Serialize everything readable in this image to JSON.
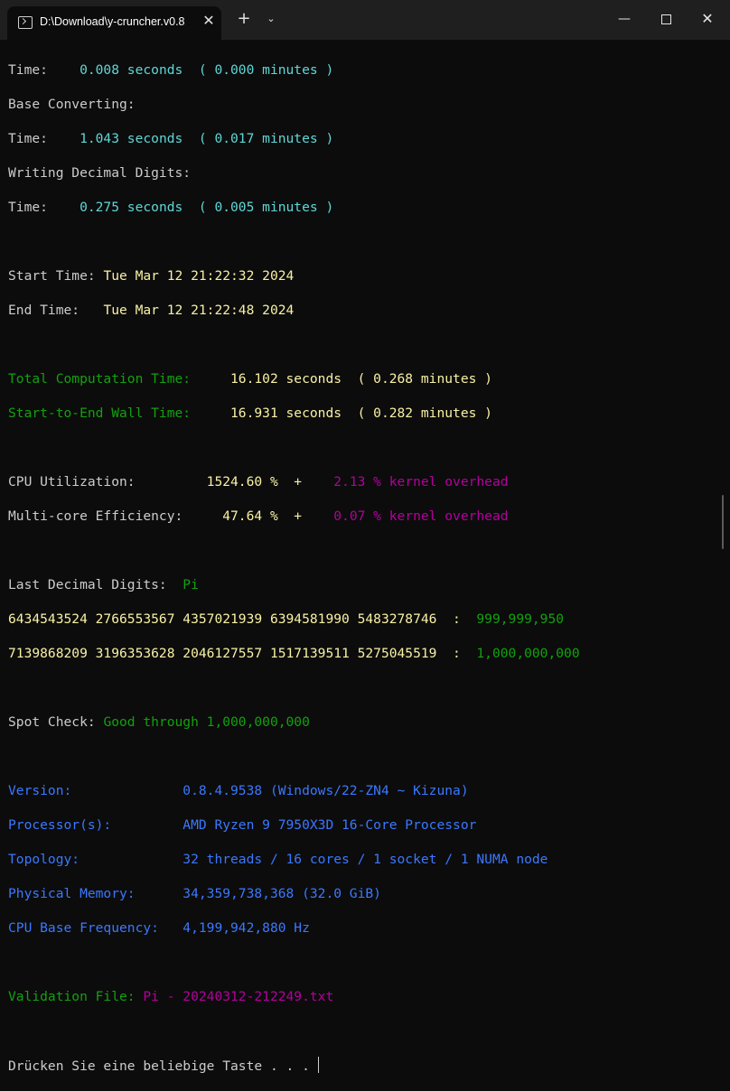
{
  "window": {
    "tab_title": "D:\\Download\\y-cruncher.v0.8",
    "tab_close": "✕",
    "new_tab": "+",
    "dropdown": "⌄",
    "minimize": "—",
    "close": "✕"
  },
  "colors": {
    "background": "#0c0c0c",
    "text": "#cccccc",
    "cyan": "#61d6d6",
    "yellow": "#f9f1a5",
    "green": "#13a10e",
    "magenta": "#b4009e",
    "blue": "#3b78ff"
  },
  "terminal": {
    "l0_label": "Time:    ",
    "l0_value": "0.008 seconds  ( 0.000 minutes )",
    "l1": "Base Converting:",
    "l2_label": "Time:    ",
    "l2_value": "1.043 seconds  ( 0.017 minutes )",
    "l3": "Writing Decimal Digits:",
    "l4_label": "Time:    ",
    "l4_value": "0.275 seconds  ( 0.005 minutes )",
    "l6_label": "Start Time: ",
    "l6_value": "Tue Mar 12 21:22:32 2024",
    "l7_label": "End Time:   ",
    "l7_value": "Tue Mar 12 21:22:48 2024",
    "l9_label": "Total Computation Time:     ",
    "l9_value": "16.102 seconds  ( 0.268 minutes )",
    "l10_label": "Start-to-End Wall Time:     ",
    "l10_value": "16.931 seconds  ( 0.282 minutes )",
    "l12_label": "CPU Utilization:         ",
    "l12_value": "1524.60 %  +    ",
    "l12_extra": "2.13 % kernel overhead",
    "l13_label": "Multi-core Efficiency:     ",
    "l13_value": "47.64 %  +    ",
    "l13_extra": "0.07 % kernel overhead",
    "l15_label": "Last Decimal Digits:  ",
    "l15_value": "Pi",
    "l16_value": "6434543524 2766553567 4357021939 6394581990 5483278746  :  ",
    "l16_extra": "999,999,950",
    "l17_value": "7139868209 3196353628 2046127557 1517139511 5275045519  :  ",
    "l17_extra": "1,000,000,000",
    "l19_label": "Spot Check: ",
    "l19_value": "Good through 1,000,000,000",
    "l21_label": "Version:              ",
    "l21_value": "0.8.4.9538 (Windows/22-ZN4 ~ Kizuna)",
    "l22_label": "Processor(s):         ",
    "l22_value": "AMD Ryzen 9 7950X3D 16-Core Processor",
    "l23_label": "Topology:             ",
    "l23_value": "32 threads / 16 cores / 1 socket / 1 NUMA node",
    "l24_label": "Physical Memory:      ",
    "l24_value": "34,359,738,368 (32.0 GiB)",
    "l25_label": "CPU Base Frequency:   ",
    "l25_value": "4,199,942,880 Hz",
    "l27_label": "Validation File: ",
    "l27_value": "Pi - 20240312-212249.txt",
    "l29": "Drücken Sie eine beliebige Taste . . . "
  }
}
